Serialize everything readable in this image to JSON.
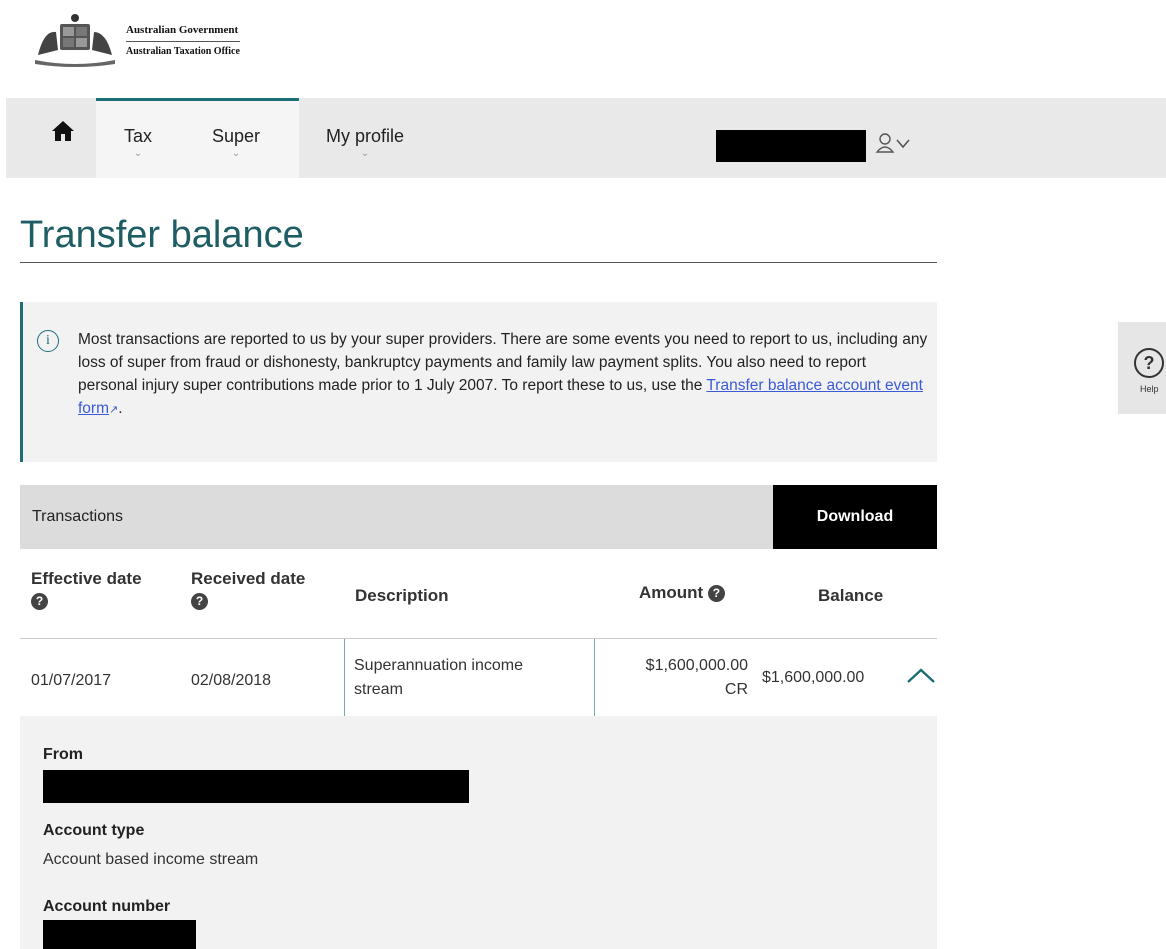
{
  "header": {
    "org_line1": "Australian Government",
    "org_line2": "Australian Taxation Office"
  },
  "nav": {
    "items": [
      {
        "label": "Tax"
      },
      {
        "label": "Super"
      },
      {
        "label": "My profile"
      }
    ],
    "home_icon": "home-icon",
    "user_icon": "user-chevron-icon"
  },
  "page": {
    "title": "Transfer balance"
  },
  "info": {
    "icon": "info-icon",
    "text": "Most transactions are reported to us by your super providers. There are some events you need to report to us, including any loss of super from fraud or dishonesty, bankruptcy payments and family law payment splits. You also need to report personal injury super contributions made prior to 1 July 2007. To report these to us, use the ",
    "link": "Transfer balance account event form",
    "after": "."
  },
  "transactions": {
    "title": "Transactions",
    "download_label": "Download",
    "columns": {
      "effective_date": "Effective date",
      "received_date": "Received date",
      "description": "Description",
      "amount": "Amount",
      "balance": "Balance"
    },
    "rows": [
      {
        "effective_date": "01/07/2017",
        "received_date": "02/08/2018",
        "description_line1": "Superannuation income",
        "description_line2": "stream",
        "amount_line1": "$1,600,000.00",
        "amount_line2": "CR",
        "balance": "$1,600,000.00"
      }
    ]
  },
  "details": {
    "from_label": "From",
    "account_type_label": "Account type",
    "account_type_value": "Account based income stream",
    "account_number_label": "Account number"
  },
  "help_tab": {
    "label": "Help"
  },
  "colors": {
    "accent": "#1c6e76",
    "link": "#3b5bd6"
  }
}
